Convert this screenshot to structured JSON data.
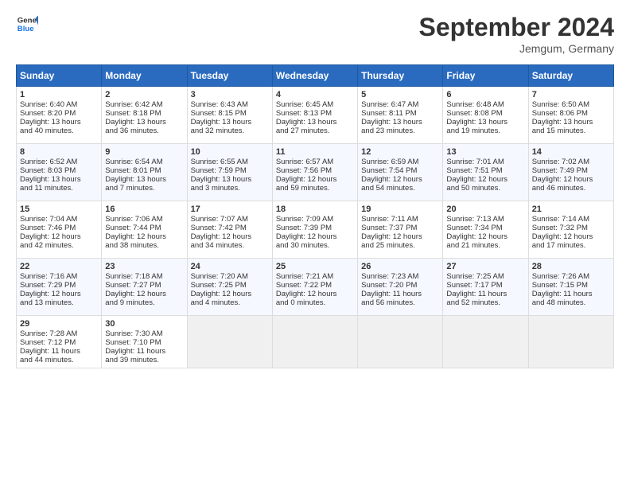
{
  "header": {
    "logo_line1": "General",
    "logo_line2": "Blue",
    "month": "September 2024",
    "location": "Jemgum, Germany"
  },
  "weekdays": [
    "Sunday",
    "Monday",
    "Tuesday",
    "Wednesday",
    "Thursday",
    "Friday",
    "Saturday"
  ],
  "weeks": [
    [
      {
        "day": "1",
        "lines": [
          "Sunrise: 6:40 AM",
          "Sunset: 8:20 PM",
          "Daylight: 13 hours",
          "and 40 minutes."
        ]
      },
      {
        "day": "2",
        "lines": [
          "Sunrise: 6:42 AM",
          "Sunset: 8:18 PM",
          "Daylight: 13 hours",
          "and 36 minutes."
        ]
      },
      {
        "day": "3",
        "lines": [
          "Sunrise: 6:43 AM",
          "Sunset: 8:15 PM",
          "Daylight: 13 hours",
          "and 32 minutes."
        ]
      },
      {
        "day": "4",
        "lines": [
          "Sunrise: 6:45 AM",
          "Sunset: 8:13 PM",
          "Daylight: 13 hours",
          "and 27 minutes."
        ]
      },
      {
        "day": "5",
        "lines": [
          "Sunrise: 6:47 AM",
          "Sunset: 8:11 PM",
          "Daylight: 13 hours",
          "and 23 minutes."
        ]
      },
      {
        "day": "6",
        "lines": [
          "Sunrise: 6:48 AM",
          "Sunset: 8:08 PM",
          "Daylight: 13 hours",
          "and 19 minutes."
        ]
      },
      {
        "day": "7",
        "lines": [
          "Sunrise: 6:50 AM",
          "Sunset: 8:06 PM",
          "Daylight: 13 hours",
          "and 15 minutes."
        ]
      }
    ],
    [
      {
        "day": "8",
        "lines": [
          "Sunrise: 6:52 AM",
          "Sunset: 8:03 PM",
          "Daylight: 13 hours",
          "and 11 minutes."
        ]
      },
      {
        "day": "9",
        "lines": [
          "Sunrise: 6:54 AM",
          "Sunset: 8:01 PM",
          "Daylight: 13 hours",
          "and 7 minutes."
        ]
      },
      {
        "day": "10",
        "lines": [
          "Sunrise: 6:55 AM",
          "Sunset: 7:59 PM",
          "Daylight: 13 hours",
          "and 3 minutes."
        ]
      },
      {
        "day": "11",
        "lines": [
          "Sunrise: 6:57 AM",
          "Sunset: 7:56 PM",
          "Daylight: 12 hours",
          "and 59 minutes."
        ]
      },
      {
        "day": "12",
        "lines": [
          "Sunrise: 6:59 AM",
          "Sunset: 7:54 PM",
          "Daylight: 12 hours",
          "and 54 minutes."
        ]
      },
      {
        "day": "13",
        "lines": [
          "Sunrise: 7:01 AM",
          "Sunset: 7:51 PM",
          "Daylight: 12 hours",
          "and 50 minutes."
        ]
      },
      {
        "day": "14",
        "lines": [
          "Sunrise: 7:02 AM",
          "Sunset: 7:49 PM",
          "Daylight: 12 hours",
          "and 46 minutes."
        ]
      }
    ],
    [
      {
        "day": "15",
        "lines": [
          "Sunrise: 7:04 AM",
          "Sunset: 7:46 PM",
          "Daylight: 12 hours",
          "and 42 minutes."
        ]
      },
      {
        "day": "16",
        "lines": [
          "Sunrise: 7:06 AM",
          "Sunset: 7:44 PM",
          "Daylight: 12 hours",
          "and 38 minutes."
        ]
      },
      {
        "day": "17",
        "lines": [
          "Sunrise: 7:07 AM",
          "Sunset: 7:42 PM",
          "Daylight: 12 hours",
          "and 34 minutes."
        ]
      },
      {
        "day": "18",
        "lines": [
          "Sunrise: 7:09 AM",
          "Sunset: 7:39 PM",
          "Daylight: 12 hours",
          "and 30 minutes."
        ]
      },
      {
        "day": "19",
        "lines": [
          "Sunrise: 7:11 AM",
          "Sunset: 7:37 PM",
          "Daylight: 12 hours",
          "and 25 minutes."
        ]
      },
      {
        "day": "20",
        "lines": [
          "Sunrise: 7:13 AM",
          "Sunset: 7:34 PM",
          "Daylight: 12 hours",
          "and 21 minutes."
        ]
      },
      {
        "day": "21",
        "lines": [
          "Sunrise: 7:14 AM",
          "Sunset: 7:32 PM",
          "Daylight: 12 hours",
          "and 17 minutes."
        ]
      }
    ],
    [
      {
        "day": "22",
        "lines": [
          "Sunrise: 7:16 AM",
          "Sunset: 7:29 PM",
          "Daylight: 12 hours",
          "and 13 minutes."
        ]
      },
      {
        "day": "23",
        "lines": [
          "Sunrise: 7:18 AM",
          "Sunset: 7:27 PM",
          "Daylight: 12 hours",
          "and 9 minutes."
        ]
      },
      {
        "day": "24",
        "lines": [
          "Sunrise: 7:20 AM",
          "Sunset: 7:25 PM",
          "Daylight: 12 hours",
          "and 4 minutes."
        ]
      },
      {
        "day": "25",
        "lines": [
          "Sunrise: 7:21 AM",
          "Sunset: 7:22 PM",
          "Daylight: 12 hours",
          "and 0 minutes."
        ]
      },
      {
        "day": "26",
        "lines": [
          "Sunrise: 7:23 AM",
          "Sunset: 7:20 PM",
          "Daylight: 11 hours",
          "and 56 minutes."
        ]
      },
      {
        "day": "27",
        "lines": [
          "Sunrise: 7:25 AM",
          "Sunset: 7:17 PM",
          "Daylight: 11 hours",
          "and 52 minutes."
        ]
      },
      {
        "day": "28",
        "lines": [
          "Sunrise: 7:26 AM",
          "Sunset: 7:15 PM",
          "Daylight: 11 hours",
          "and 48 minutes."
        ]
      }
    ],
    [
      {
        "day": "29",
        "lines": [
          "Sunrise: 7:28 AM",
          "Sunset: 7:12 PM",
          "Daylight: 11 hours",
          "and 44 minutes."
        ]
      },
      {
        "day": "30",
        "lines": [
          "Sunrise: 7:30 AM",
          "Sunset: 7:10 PM",
          "Daylight: 11 hours",
          "and 39 minutes."
        ]
      },
      {
        "day": "",
        "lines": []
      },
      {
        "day": "",
        "lines": []
      },
      {
        "day": "",
        "lines": []
      },
      {
        "day": "",
        "lines": []
      },
      {
        "day": "",
        "lines": []
      }
    ]
  ]
}
